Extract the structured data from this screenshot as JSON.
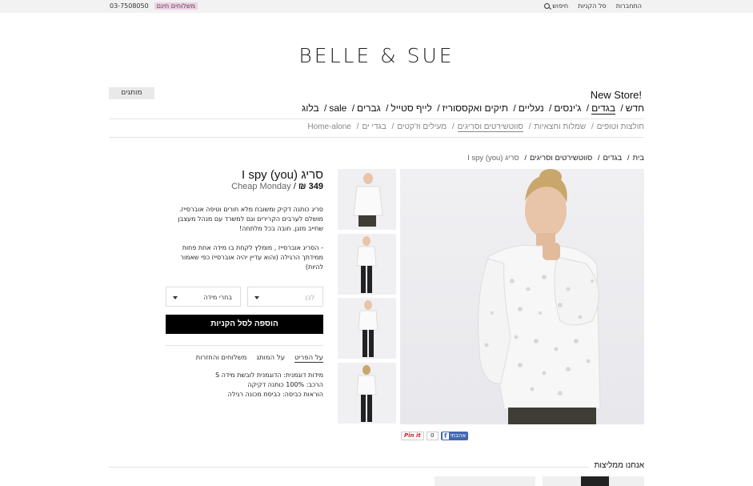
{
  "topbar": {
    "phone": "03-7508050",
    "shipping": "משלוחים חינם",
    "search": "חיפוש",
    "cart": "סל הקניות",
    "login": "התחברות"
  },
  "logo": "BELLE & SUE",
  "brands_button": "מותגים",
  "new_store": "New Store!",
  "main_nav": [
    "חדש",
    "בגדים",
    "ג'ינסים",
    "נעליים",
    "תיקים ואקססוריז",
    "לייף סטייל",
    "גברים",
    "sale",
    "בלוג"
  ],
  "sub_nav": [
    "חולצות וטופים",
    "שמלות וחצאיות",
    "סווטשירטים וסריגים",
    "מעילים וז'קטים",
    "בגדי ים",
    "Home-alone"
  ],
  "breadcrumb": [
    "בית",
    "בגדים",
    "סווטשירטים וסריגים",
    "סריג I spy (you)"
  ],
  "product": {
    "title": "סריג I spy (you)",
    "price": "349 ₪",
    "brand": "Cheap Monday",
    "description": [
      "סריג כותנה דקיק ומשובח מלא חורים וטיפה אוברסייז. מושלם לערבים הקרירים וגם למשרד עם מנהל מעצבן שחייב מזגן. חובה בכל מלתחה!",
      "- הסריג אוברסייז , מומלץ לקחת בו מידה אחת פחות ממידתך הרגילה (והוא עדיין יהיה אוברסייז כפי שאמור להיות)"
    ],
    "color_placeholder": "לבן",
    "size_placeholder": "בחרי מידה",
    "add_to_cart": "הוספה לסל הקניות",
    "tabs": [
      "על הפריט",
      "על המותג",
      "משלוחים והחזרות"
    ],
    "details": [
      "מידות דוגמנית: הדוגמנית לובשת מידה S",
      "הרכב: 100% כותנה דקיקה",
      "הוראות כביסה: כביסת מכונה רגילה"
    ]
  },
  "social": {
    "fb_label": "אהבתי",
    "count": "0",
    "pinterest": "Pin it"
  },
  "recommend_title": "אנחנו ממליצות",
  "colors": {
    "accent_pink": "#f1cfe6",
    "button_black": "#000000",
    "facebook": "#4267b2"
  }
}
